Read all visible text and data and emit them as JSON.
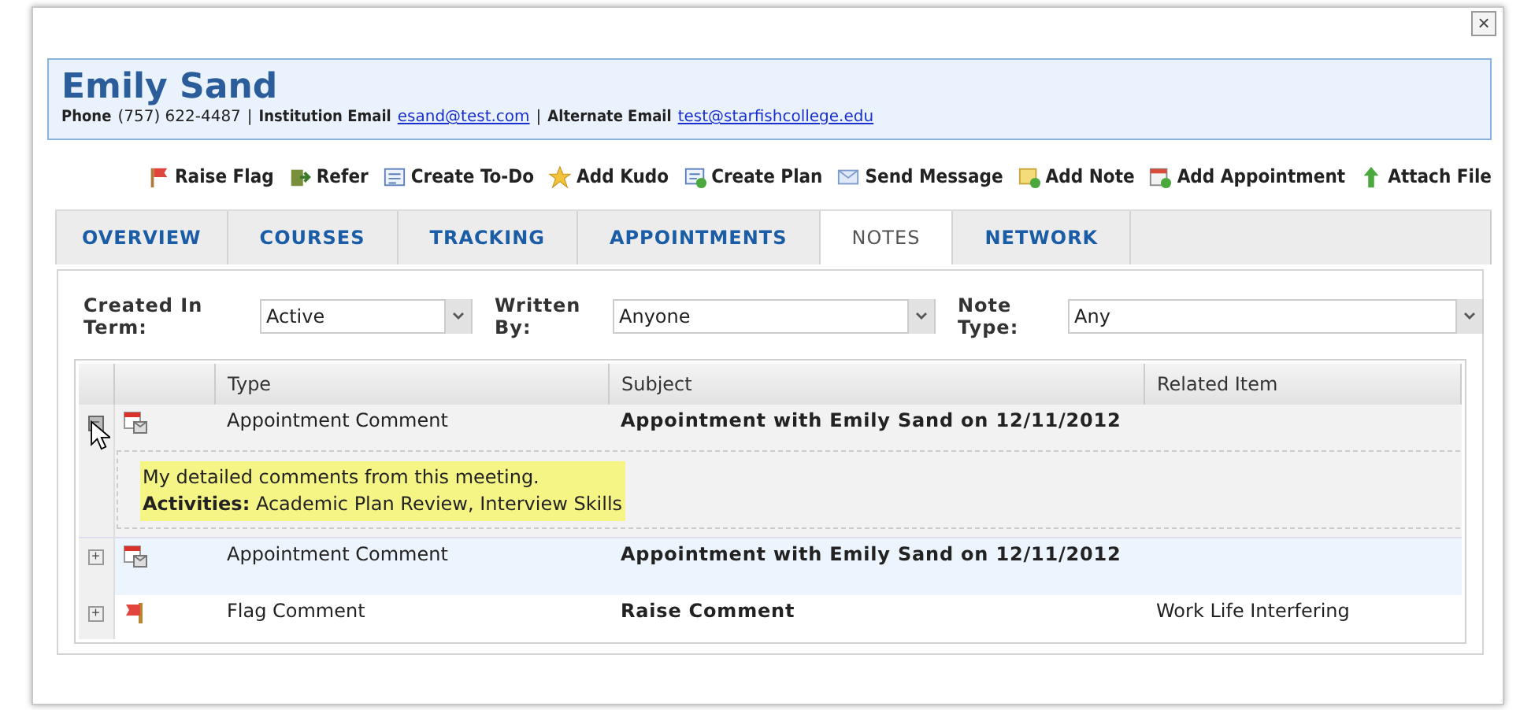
{
  "dialog": {
    "close": "×"
  },
  "student": {
    "name": "Emily Sand",
    "contacts": [
      {
        "label": "Phone",
        "value": "(757) 622-4487",
        "link": false
      },
      {
        "label": "Institution Email",
        "value": "esand@test.com",
        "link": true
      },
      {
        "label": "Alternate Email",
        "value": "test@starfishcollege.edu",
        "link": true
      }
    ],
    "separator": "|"
  },
  "actions": [
    {
      "label": "Raise Flag",
      "kind": "flag"
    },
    {
      "label": "Refer",
      "kind": "refer"
    },
    {
      "label": "Create To-Do",
      "kind": "todo"
    },
    {
      "label": "Add Kudo",
      "kind": "kudo"
    },
    {
      "label": "Create Plan",
      "kind": "plan"
    },
    {
      "label": "Send Message",
      "kind": "message"
    },
    {
      "label": "Add Note",
      "kind": "note"
    },
    {
      "label": "Add Appointment",
      "kind": "appointment"
    },
    {
      "label": "Attach File",
      "kind": "attach"
    }
  ],
  "tabs": [
    {
      "label": "OVERVIEW",
      "selected": false
    },
    {
      "label": "COURSES",
      "selected": false
    },
    {
      "label": "TRACKING",
      "selected": false
    },
    {
      "label": "APPOINTMENTS",
      "selected": false
    },
    {
      "label": "NOTES",
      "selected": true
    },
    {
      "label": "NETWORK",
      "selected": false
    }
  ],
  "filters": [
    {
      "label": "Created In Term:",
      "value": "Active"
    },
    {
      "label": "Written By:",
      "value": "Anyone"
    },
    {
      "label": "Note Type:",
      "value": "Any"
    }
  ],
  "table": {
    "columns": [
      "Type",
      "Subject",
      "Related Item"
    ],
    "rows": [
      {
        "kind": "appointment",
        "expanded": true,
        "selected": false,
        "expander": "−",
        "type": "Appointment Comment",
        "subject": "Appointment with Emily Sand on 12/11/2012",
        "detail": {
          "comment": "My detailed comments from this meeting.",
          "activities": "**Activities:** Academic Plan Review, Interview Skills"
        }
      },
      {
        "kind": "appointment",
        "expanded": false,
        "selected": true,
        "expander": "+",
        "type": "Appointment Comment",
        "subject": "Appointment with Emily Sand on 12/11/2012"
      },
      {
        "kind": "flag",
        "expanded": false,
        "selected": false,
        "expander": "+",
        "type": "Flag Comment",
        "subject": "Raise Comment",
        "related": "Work Life Interfering"
      }
    ]
  }
}
